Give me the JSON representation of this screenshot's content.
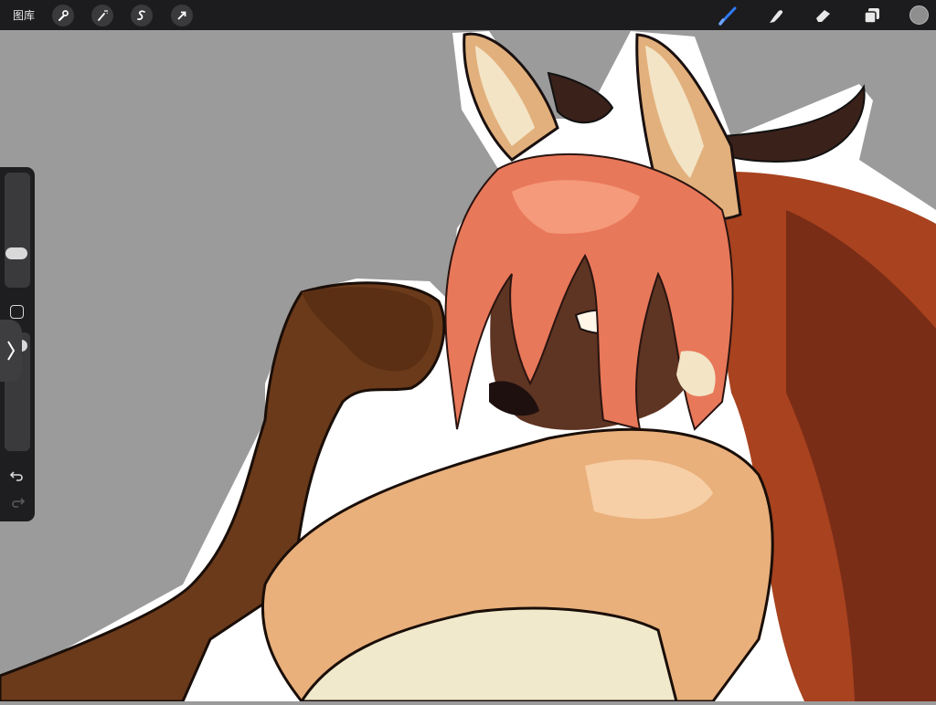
{
  "topbar": {
    "gallery_label": "图库",
    "left_tools": [
      {
        "name": "actions",
        "icon": "wrench-icon"
      },
      {
        "name": "adjustments",
        "icon": "magic-wand-icon"
      },
      {
        "name": "selection",
        "icon": "selection-s-icon"
      },
      {
        "name": "transform",
        "icon": "arrow-cursor-icon"
      }
    ],
    "right_tools": [
      {
        "name": "brush",
        "icon": "brush-icon",
        "active": true
      },
      {
        "name": "smudge",
        "icon": "smudge-finger-icon"
      },
      {
        "name": "eraser",
        "icon": "eraser-icon"
      },
      {
        "name": "layers",
        "icon": "layers-icon"
      }
    ],
    "active_color": "#8e8e8e",
    "accent": "#2f7bf5"
  },
  "sidebar": {
    "brush_size_level": 0.2,
    "opacity_level": 0.95,
    "modify_icon": "square-icon",
    "collapse_icon": "chevron-right-icon",
    "undo_icon": "undo-icon",
    "redo_icon": "redo-icon",
    "redo_enabled": false
  },
  "canvas": {
    "background": "#9b9b9b",
    "artwork": "anime-fox-character-illustration"
  }
}
